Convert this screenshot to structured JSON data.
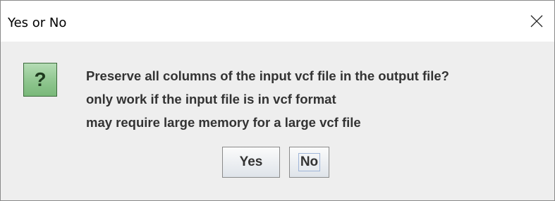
{
  "window": {
    "title": "Yes or No",
    "close_icon": "close-icon"
  },
  "dialog": {
    "icon": "question-icon",
    "icon_glyph": "?",
    "message_lines": [
      "Preserve all columns of the input vcf file in the output file?",
      "only work if the input file is in vcf format",
      "may require large memory for a large vcf file"
    ],
    "buttons": {
      "yes_label": "Yes",
      "no_label": "No"
    },
    "focused_button": "No"
  },
  "colors": {
    "dialog_background": "#eeeeee",
    "titlebar_background": "#ffffff",
    "icon_green": "#8fc68f",
    "text": "#333333"
  }
}
